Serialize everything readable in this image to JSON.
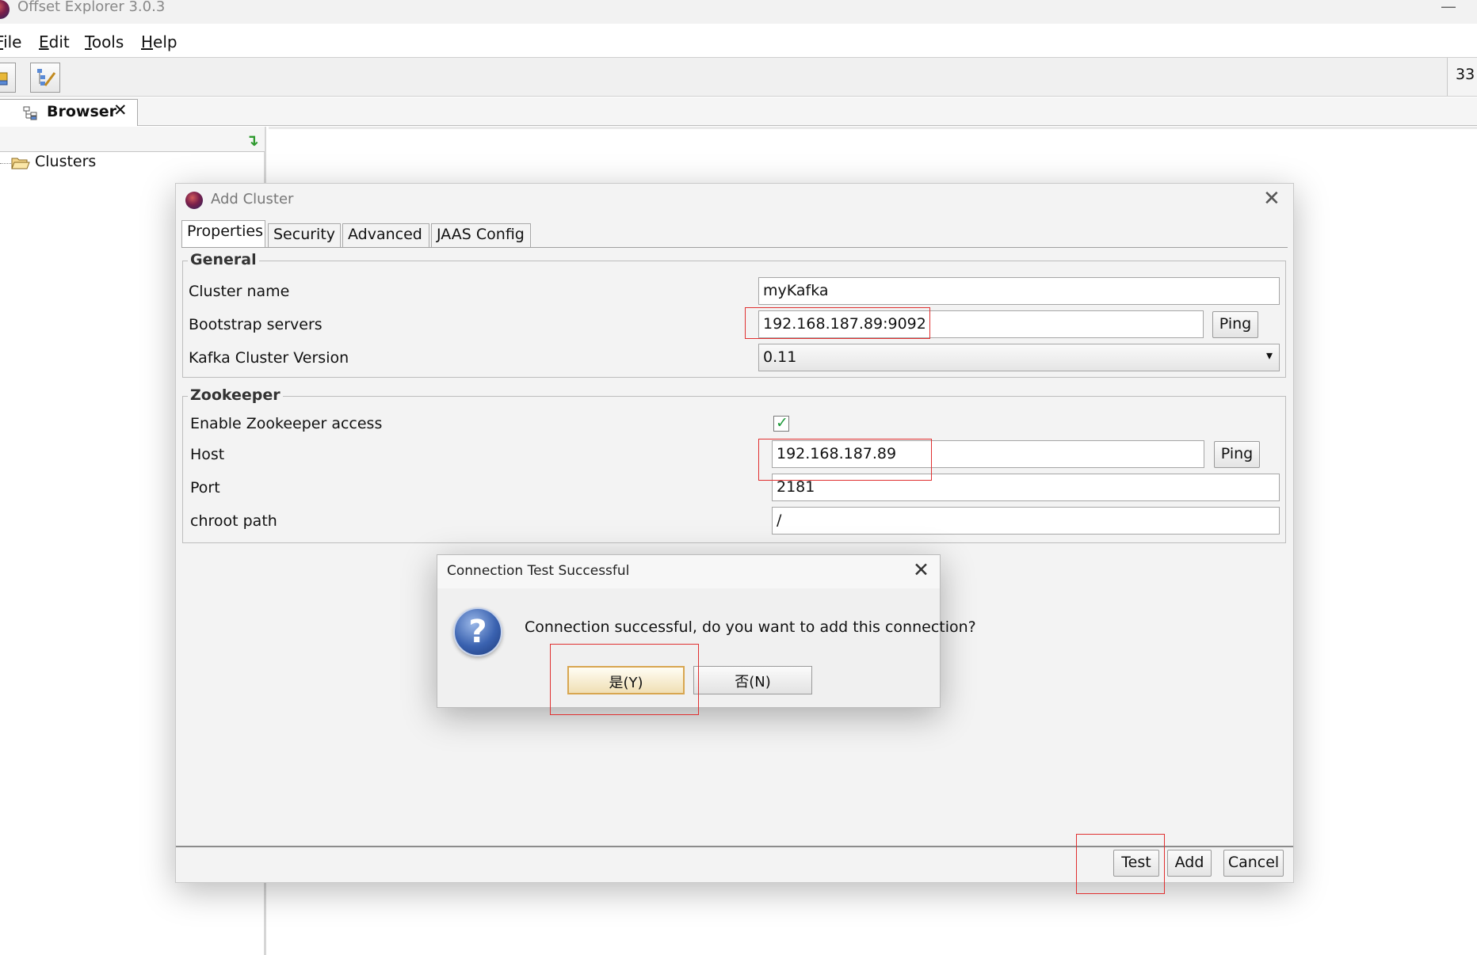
{
  "app": {
    "title": "Offset Explorer  3.0.3",
    "minimize_glyph": "—"
  },
  "menubar": {
    "items": [
      {
        "label": "File",
        "mnemonic": "F"
      },
      {
        "label": "Edit",
        "mnemonic": "E"
      },
      {
        "label": "Tools",
        "mnemonic": "T"
      },
      {
        "label": "Help",
        "mnemonic": "H"
      }
    ]
  },
  "toolbar": {
    "right_text": "33"
  },
  "browser_tab": {
    "label": "Browser",
    "close_glyph": "✕"
  },
  "tree": {
    "root_label": "Clusters"
  },
  "add_cluster": {
    "title": "Add Cluster",
    "close_glyph": "✕",
    "tabs": [
      "Properties",
      "Security",
      "Advanced",
      "JAAS Config"
    ],
    "active_tab": "Properties",
    "general": {
      "title": "General",
      "cluster_name_label": "Cluster name",
      "cluster_name_value": "myKafka",
      "bootstrap_label": "Bootstrap servers",
      "bootstrap_value": "192.168.187.89:9092",
      "version_label": "Kafka Cluster Version",
      "version_value": "0.11",
      "ping_label": "Ping"
    },
    "zookeeper": {
      "title": "Zookeeper",
      "enable_label": "Enable Zookeeper access",
      "enable_checked": true,
      "host_label": "Host",
      "host_value": "192.168.187.89",
      "port_label": "Port",
      "port_value": "2181",
      "chroot_label": "chroot path",
      "chroot_value": "/",
      "ping_label": "Ping"
    },
    "footer": {
      "test_label": "Test",
      "add_label": "Add",
      "cancel_label": "Cancel"
    }
  },
  "confirm_dialog": {
    "title": "Connection Test Successful",
    "close_glyph": "✕",
    "message": "Connection successful, do you want to add this connection?",
    "icon_glyph": "?",
    "yes_label": "是(Y)",
    "no_label": "否(N)"
  },
  "colors": {
    "highlight_box": "#e03030",
    "checkmark": "#1f9a3a",
    "default_button_border": "#d8a650"
  }
}
